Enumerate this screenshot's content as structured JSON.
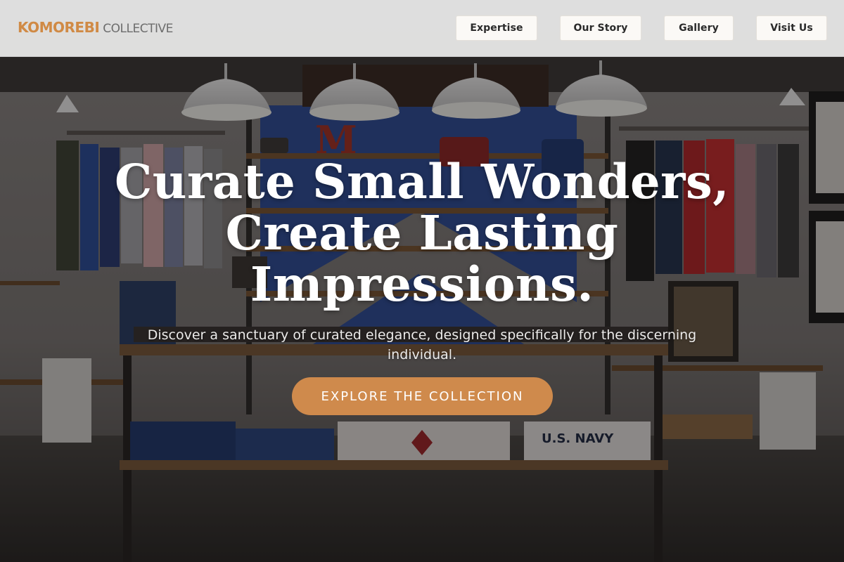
{
  "brand": {
    "name": "KOMOREBI",
    "suffix": "COLLECTIVE",
    "accent_color": "#d08a45"
  },
  "nav": {
    "items": [
      {
        "label": "Expertise"
      },
      {
        "label": "Our Story"
      },
      {
        "label": "Gallery"
      },
      {
        "label": "Visit Us"
      }
    ]
  },
  "hero": {
    "headline_line1": "Curate Small Wonders,",
    "headline_line2": "Create Lasting",
    "headline_line3": "Impressions.",
    "subheadline": "Discover a sanctuary of curated elegance, designed specifically for the discerning individual.",
    "cta_label": "EXPLORE THE COLLECTION",
    "cta_color": "#cf8a4c",
    "sign_text_left": "M",
    "sign_text_table": "U.S. NAVY"
  }
}
